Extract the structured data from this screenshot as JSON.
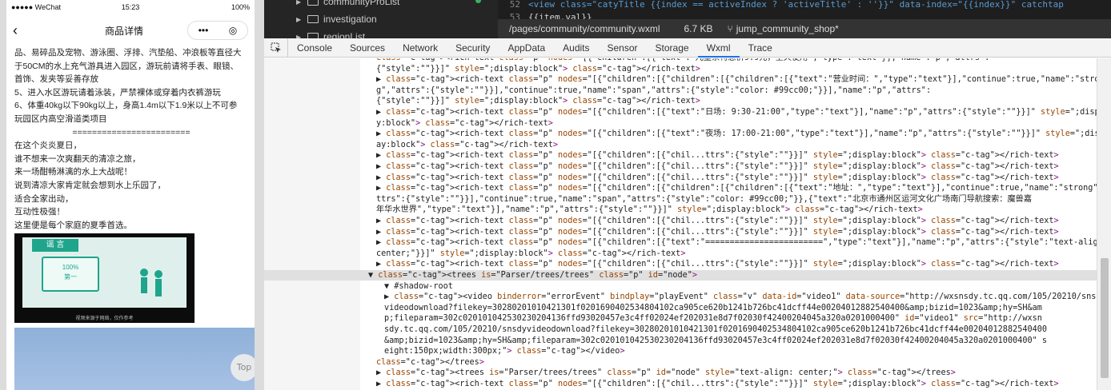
{
  "phone": {
    "status": {
      "carrier": "●●●●● WeChat",
      "time": "15:23",
      "battery": "100%"
    },
    "nav": {
      "back": "‹",
      "title": "商品详情",
      "menu": "•••",
      "close": "◎"
    },
    "paragraphs": [
      "品、易碎品及宠物、游泳圈、浮排、汽垫船、冲浪板等直径大",
      "于50CM的水上充气游具进入园区，游玩前请将手表、眼镜、",
      "首饰、发夹等妥善存放",
      "5、进入水区游玩请着泳装，严禁裸体或穿着内衣裤游玩",
      "6、体重40kg以下90kg以上，身高1.4m以下1.9米以上不可参",
      "玩园区内高空滑道类项目",
      "========================",
      "在这个炎炎夏日，",
      "谁不想来一次爽翻天的清凉之旅，",
      "来一场酣畅淋漓的水上大战呢！",
      "说到清凉大家肯定就会想到水上乐园了，",
      "适合全家出动，",
      "互动性极强！",
      "这里便是每个家庭的夏季首选。"
    ],
    "banner": {
      "tag": "谣 言",
      "monitor_line1": "100%",
      "monitor_line2": "第一",
      "caption": "视频来源于网络，仅作参考"
    },
    "top_button": "Top"
  },
  "filetree": {
    "items": [
      {
        "label": "communityProList"
      },
      {
        "label": "investigation"
      },
      {
        "label": "regionList"
      }
    ]
  },
  "editor": {
    "lines": [
      {
        "num": "52",
        "text": "<view class=\"catyTitle {{index == activeIndex ? 'activeTitle' : ''}}\" data-index=\"{{index}}\" catchtap"
      },
      {
        "num": "53",
        "text": "{{item.val}}"
      }
    ],
    "path": "/pages/community/community.wxml",
    "size": "6.7 KB",
    "branch": "jump_community_shop*"
  },
  "devtools": {
    "tabs": [
      "Console",
      "Sources",
      "Network",
      "Security",
      "AppData",
      "Audits",
      "Sensor",
      "Storage",
      "Wxml",
      "Trace"
    ],
    "active_tab": "Wxml",
    "rows": [
      {
        "indent": 0,
        "text": "<rich-text class=\"p\" nodes=\"[{\"children\":[{\"text\":\"儿童票特惠价9.9元，全天使用\",\"type\":\"text\"}],\"name\":\"p\",\"attrs\":"
      },
      {
        "indent": 0,
        "text": "{\"style\":\"\"}}]\" style=\";display:block\"> </rich-text>"
      },
      {
        "indent": 0,
        "text": "▶ <rich-text class=\"p\" nodes=\"[{\"children\":[{\"children\":[{\"children\":[{\"text\":\"营业时间：\",\"type\":\"text\"}],\"continue\":true,\"name\":\"stron"
      },
      {
        "indent": 0,
        "text": "g\",\"attrs\":{\"style\":\"\"}}],\"continue\":true,\"name\":\"span\",\"attrs\":{\"style\":\"color: #99cc00;\"}}],\"name\":\"p\",\"attrs\":"
      },
      {
        "indent": 0,
        "text": "{\"style\":\"\"}}]\" style=\";display:block\"> </rich-text>"
      },
      {
        "indent": 0,
        "text": "▶ <rich-text class=\"p\" nodes=\"[{\"children\":[{\"text\":\"日场: 9:30-21:00\",\"type\":\"text\"}],\"name\":\"p\",\"attrs\":{\"style\":\"\"}}]\" style=\";displa"
      },
      {
        "indent": 0,
        "text": "y:block\"> </rich-text>"
      },
      {
        "indent": 0,
        "text": "▶ <rich-text class=\"p\" nodes=\"[{\"children\":[{\"text\":\"夜场: 17:00-21:00\",\"type\":\"text\"}],\"name\":\"p\",\"attrs\":{\"style\":\"\"}}]\" style=\";displ"
      },
      {
        "indent": 0,
        "text": "ay:block\"> </rich-text>"
      },
      {
        "indent": 0,
        "text": "▶ <rich-text class=\"p\" nodes=\"[{\"children\":[{\"chil...ttrs\":{\"style\":\"\"}}]\" style=\";display:block\"> </rich-text>"
      },
      {
        "indent": 0,
        "text": "▶ <rich-text class=\"p\" nodes=\"[{\"children\":[{\"chil...ttrs\":{\"style\":\"\"}}]\" style=\";display:block\"> </rich-text>"
      },
      {
        "indent": 0,
        "text": "▶ <rich-text class=\"p\" nodes=\"[{\"children\":[{\"chil...ttrs\":{\"style\":\"\"}}]\" style=\";display:block\"> </rich-text>"
      },
      {
        "indent": 0,
        "text": "▶ <rich-text class=\"p\" nodes=\"[{\"children\":[{\"children\":[{\"children\":[{\"text\":\"地址：\",\"type\":\"text\"}],\"continue\":true,\"name\":\"strong\",\"a"
      },
      {
        "indent": 0,
        "text": "ttrs\":{\"style\":\"\"}}],\"continue\":true,\"name\":\"span\",\"attrs\":{\"style\":\"color: #99cc00;\"}},{\"text\":\"北京市通州区运河文化广场南门导航搜索：魔兽嘉"
      },
      {
        "indent": 0,
        "text": "年华水世界\",\"type\":\"text\"}],\"name\":\"p\",\"attrs\":{\"style\":\"\"}}]\" style=\";display:block\"> </rich-text>"
      },
      {
        "indent": 0,
        "text": "▶ <rich-text class=\"p\" nodes=\"[{\"children\":[{\"chil...ttrs\":{\"style\":\"\"}}]\" style=\";display:block\"> </rich-text>"
      },
      {
        "indent": 0,
        "text": "▶ <rich-text class=\"p\" nodes=\"[{\"children\":[{\"chil...ttrs\":{\"style\":\"\"}}]\" style=\";display:block\"> </rich-text>"
      },
      {
        "indent": 0,
        "text": "▶ <rich-text class=\"p\" nodes=\"[{\"children\":[{\"text\":\"========================\",\"type\":\"text\"}],\"name\":\"p\",\"attrs\":{\"style\":\"text-align:"
      },
      {
        "indent": 0,
        "text": "center;\"}}]\" style=\";display:block\"> </rich-text>"
      },
      {
        "indent": 0,
        "text": "▶ <rich-text class=\"p\" nodes=\"[{\"children\":[{\"chil...ttrs\":{\"style\":\"\"}}]\" style=\";display:block\"> </rich-text>"
      },
      {
        "indent": 0,
        "text": "▼ <trees is=\"Parser/trees/trees\" class=\"p\" id=\"node\">",
        "hl": true
      },
      {
        "indent": 1,
        "text": "▼ #shadow-root"
      },
      {
        "indent": 1,
        "text": "▶ <video binderror=\"errorEvent\" bindplay=\"playEvent\" class=\"v\" data-id=\"video1\" data-source=\"http://wxsnsdy.tc.qq.com/105/20210/snsdy"
      },
      {
        "indent": 1,
        "text": "videodownload?filekey=30280201010421301f0201690402534804102ca905ce620b1241b726bc41dcff44e00204012882540400&amp;bizid=1023&amp;hy=SH&am"
      },
      {
        "indent": 1,
        "text": "p;fileparam=302c020101042530230204136ffd93020457e3c4ff02024ef202031e8d7f02030f42400204045a320a0201000400\" id=\"video1\" src=\"http://wxsn"
      },
      {
        "indent": 1,
        "text": "sdy.tc.qq.com/105/20210/snsdyvideodownload?filekey=30280201010421301f0201690402534804102ca905ce620b1241b726bc41dcff44e00204012882540400"
      },
      {
        "indent": 1,
        "text": "&amp;bizid=1023&amp;hy=SH&amp;fileparam=302c020101042530230204136ffd93020457e3c4ff02024ef202031e8d7f02030f42400204045a320a0201000400\" s"
      },
      {
        "indent": 1,
        "text": "eight:150px;width:300px;\"> </video>"
      },
      {
        "indent": 0,
        "text": "</trees>"
      },
      {
        "indent": 0,
        "text": "▶ <trees is=\"Parser/trees/trees\" class=\"p\" id=\"node\" style=\"text-align: center;\"> </trees>"
      },
      {
        "indent": 0,
        "text": "▶ <rich-text class=\"p\" nodes=\"[{\"children\":[{\"chil...ttrs\":{\"style\":\"\"}}]\" style=\";display:block\"> </rich-text>"
      }
    ]
  }
}
